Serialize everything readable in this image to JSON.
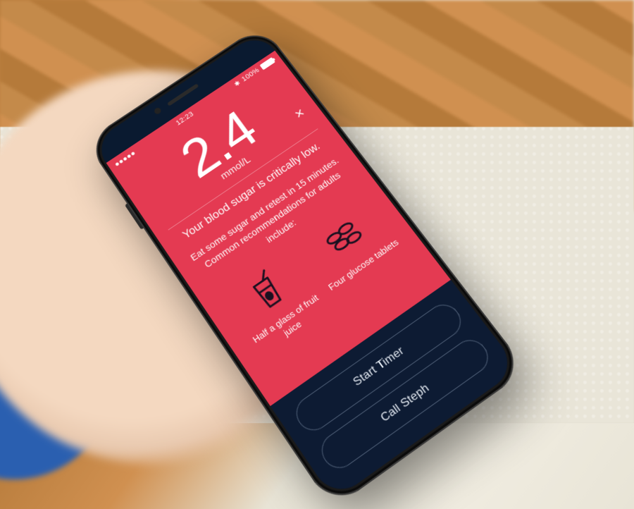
{
  "status_bar": {
    "carrier_signal_dots": 5,
    "time": "12:23",
    "bluetooth": "᛭",
    "battery_pct": "100%"
  },
  "reading": {
    "value": "2.4",
    "unit": "mmol/L"
  },
  "alert": {
    "headline": "Your blood sugar is critically low.",
    "advice": "Eat some sugar and retest in 15 minutes. Common recommendations for adults include:"
  },
  "recommendations": [
    {
      "icon": "juice-icon",
      "label": "Half a glass of fruit juice"
    },
    {
      "icon": "tablets-icon",
      "label": "Four glucose tablets"
    }
  ],
  "actions": {
    "primary": "Start Timer",
    "secondary": "Call Steph"
  },
  "colors": {
    "alert_bg": "#e43a52",
    "action_bg": "#0d1b33",
    "text": "#ffffff"
  }
}
